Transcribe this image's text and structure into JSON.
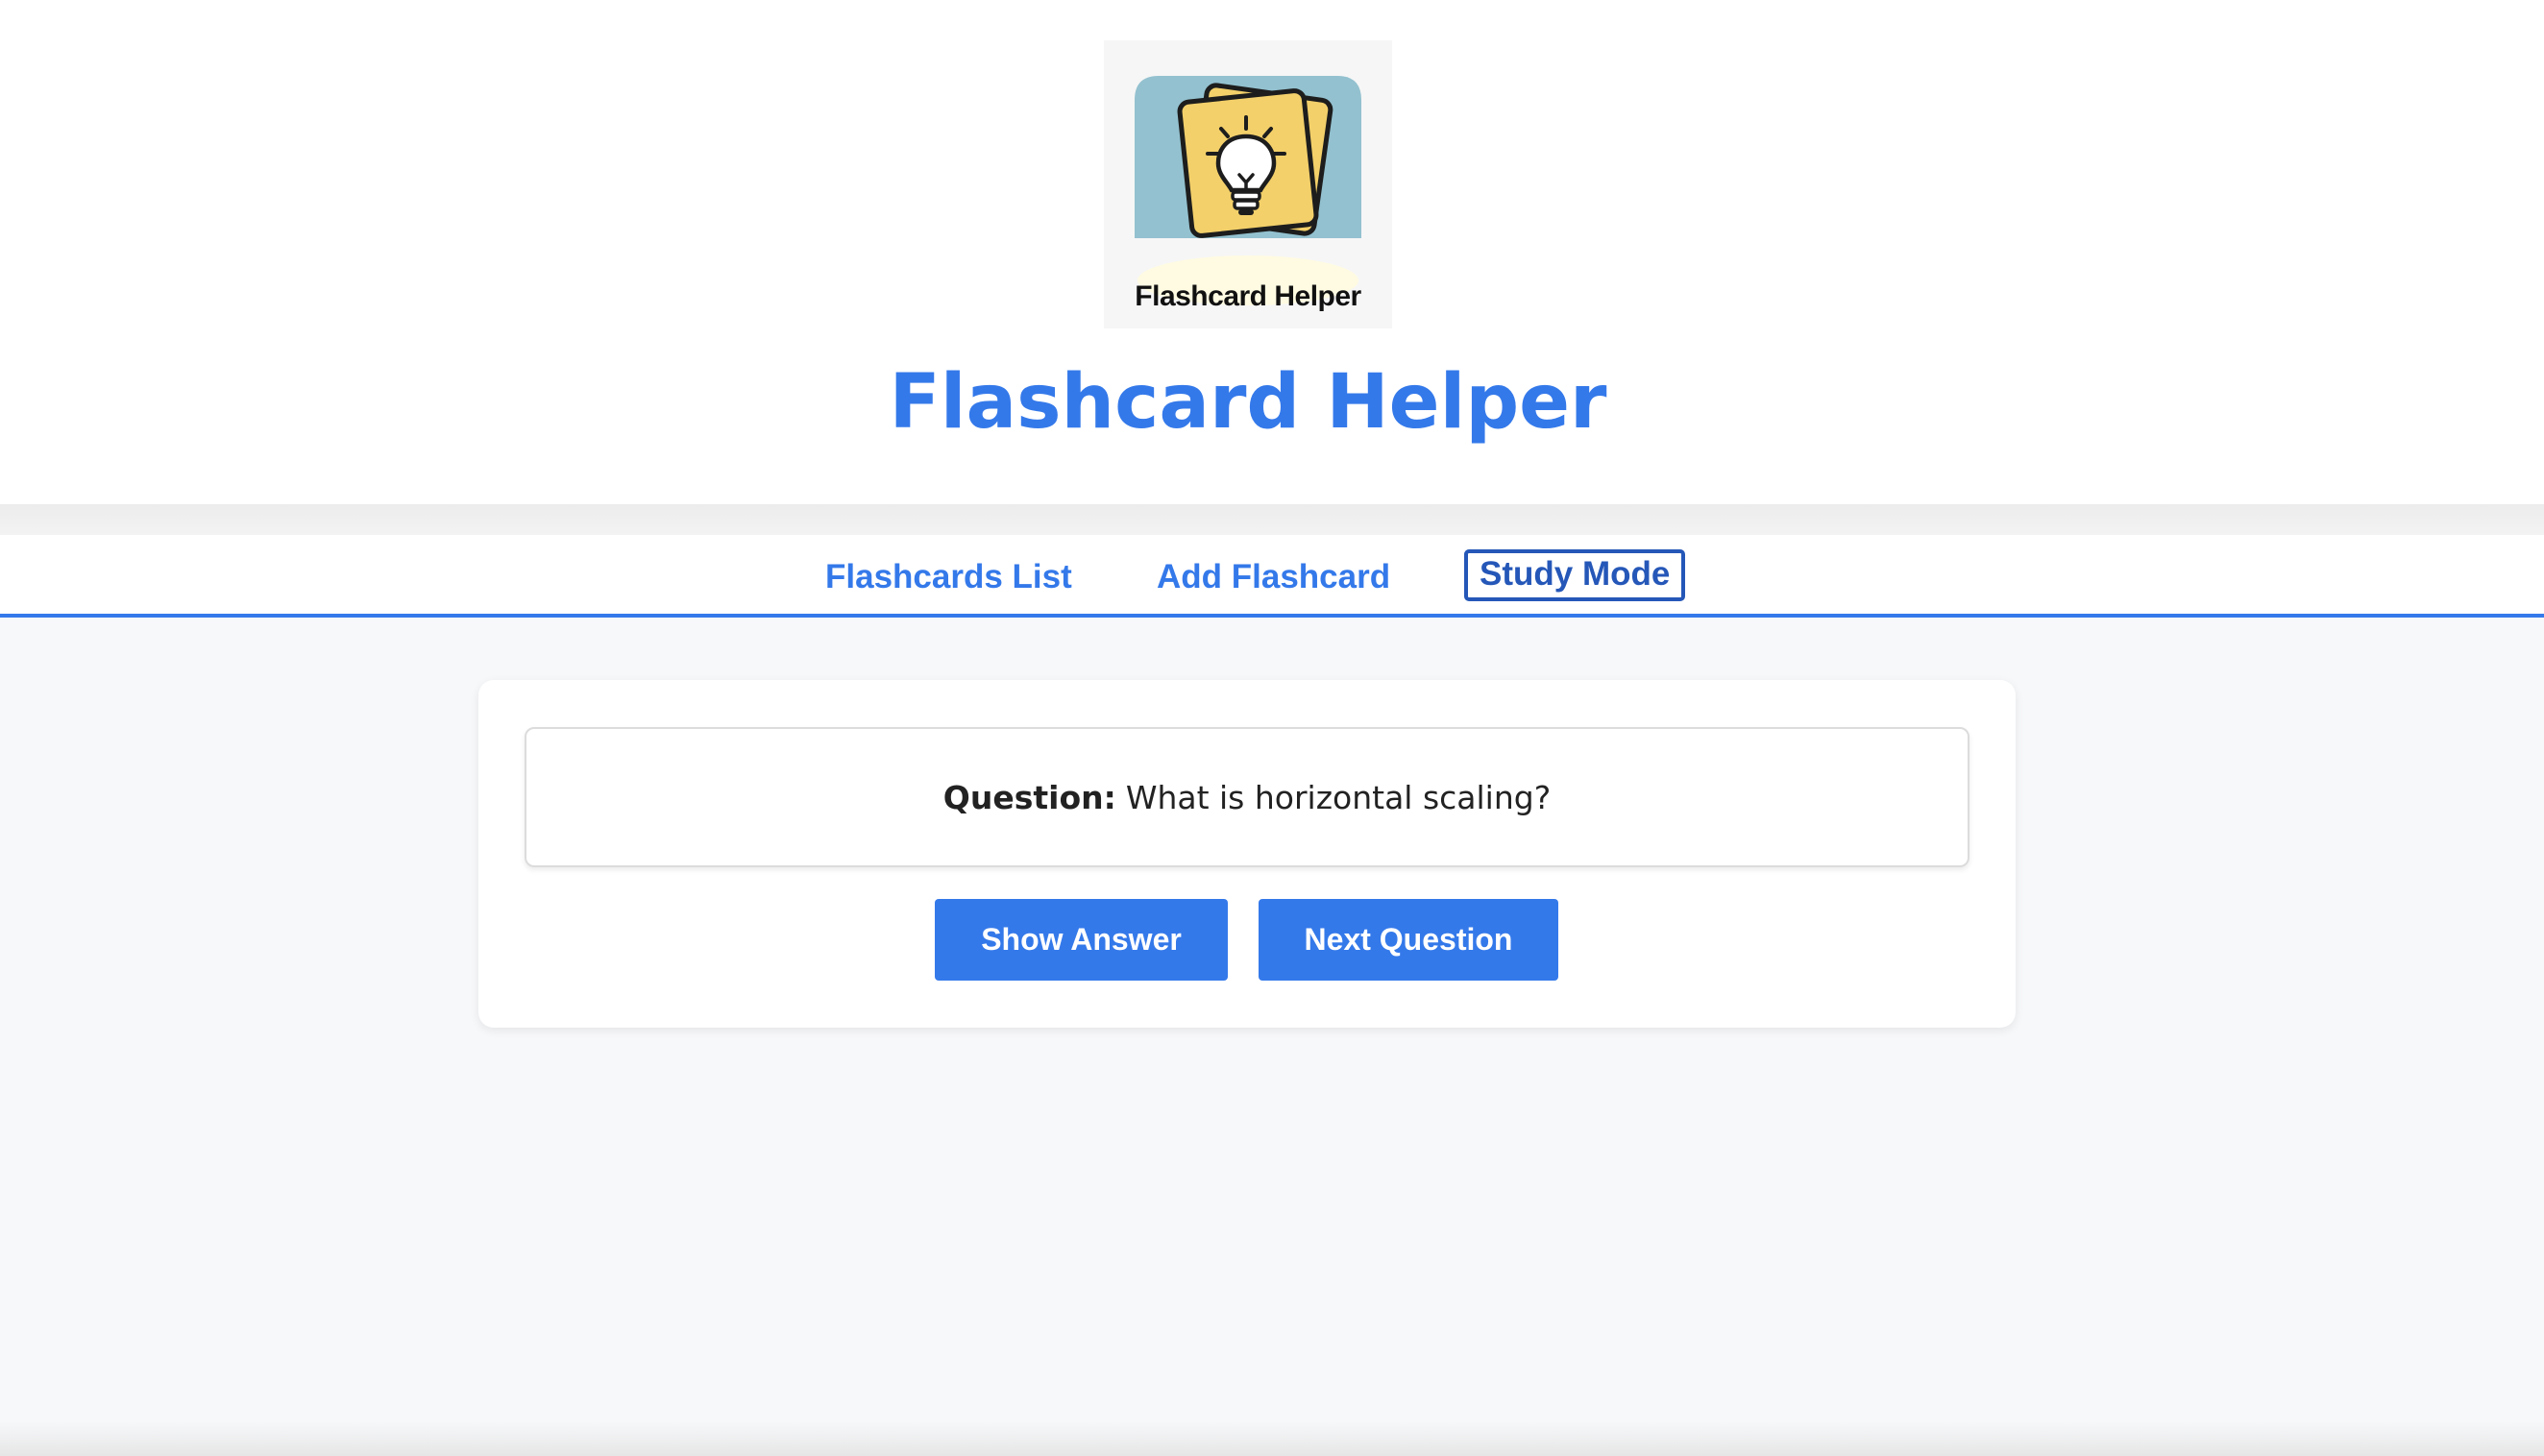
{
  "brand": {
    "logo_text": "Flashcard Helper",
    "title": "Flashcard Helper",
    "accent_color": "#3479ea"
  },
  "nav": {
    "items": [
      {
        "label": "Flashcards List",
        "active": false
      },
      {
        "label": "Add Flashcard",
        "active": false
      },
      {
        "label": "Study Mode",
        "active": true
      }
    ]
  },
  "study": {
    "question_label": "Question:",
    "question_text": "What is horizontal scaling?",
    "show_answer_label": "Show Answer",
    "next_question_label": "Next Question"
  },
  "icons": {
    "logo": "lightbulb-card-icon"
  }
}
